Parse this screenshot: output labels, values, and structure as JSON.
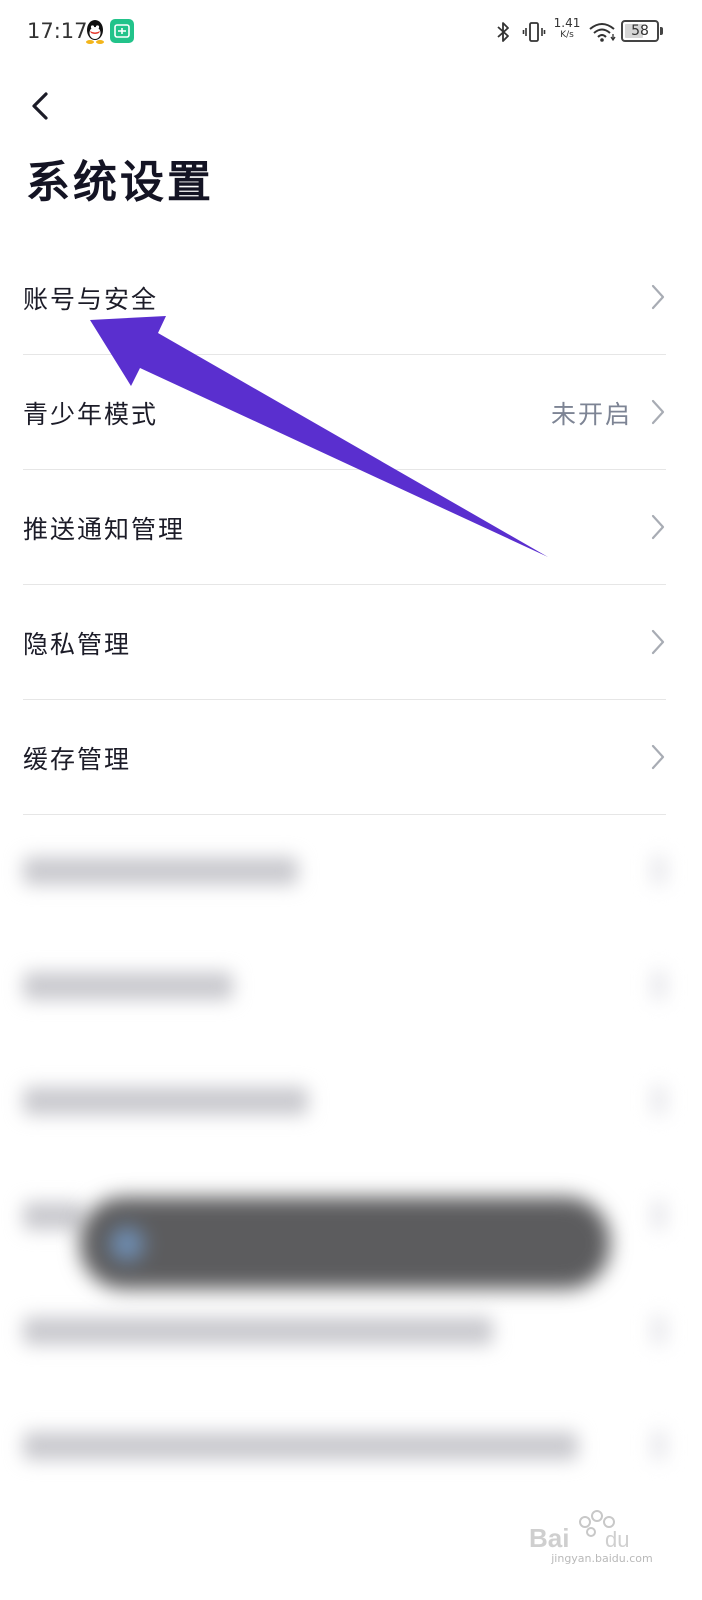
{
  "status_bar": {
    "time": "17:17",
    "net_speed_value": "1.41",
    "net_speed_unit": "K/s",
    "battery_level": "58",
    "icons": [
      "qq-icon",
      "app-badge-icon",
      "bluetooth-icon",
      "vibrate-icon",
      "wifi-icon",
      "battery-icon"
    ]
  },
  "header": {
    "title": "系统设置"
  },
  "settings": {
    "items": [
      {
        "label": "账号与安全"
      },
      {
        "label": "青少年模式",
        "value": "未开启"
      },
      {
        "label": "推送通知管理"
      },
      {
        "label": "隐私管理"
      },
      {
        "label": "缓存管理"
      }
    ]
  },
  "annotation": {
    "color": "#5a2fcf"
  },
  "watermark": {
    "text": "jingyan.baidu.com"
  }
}
